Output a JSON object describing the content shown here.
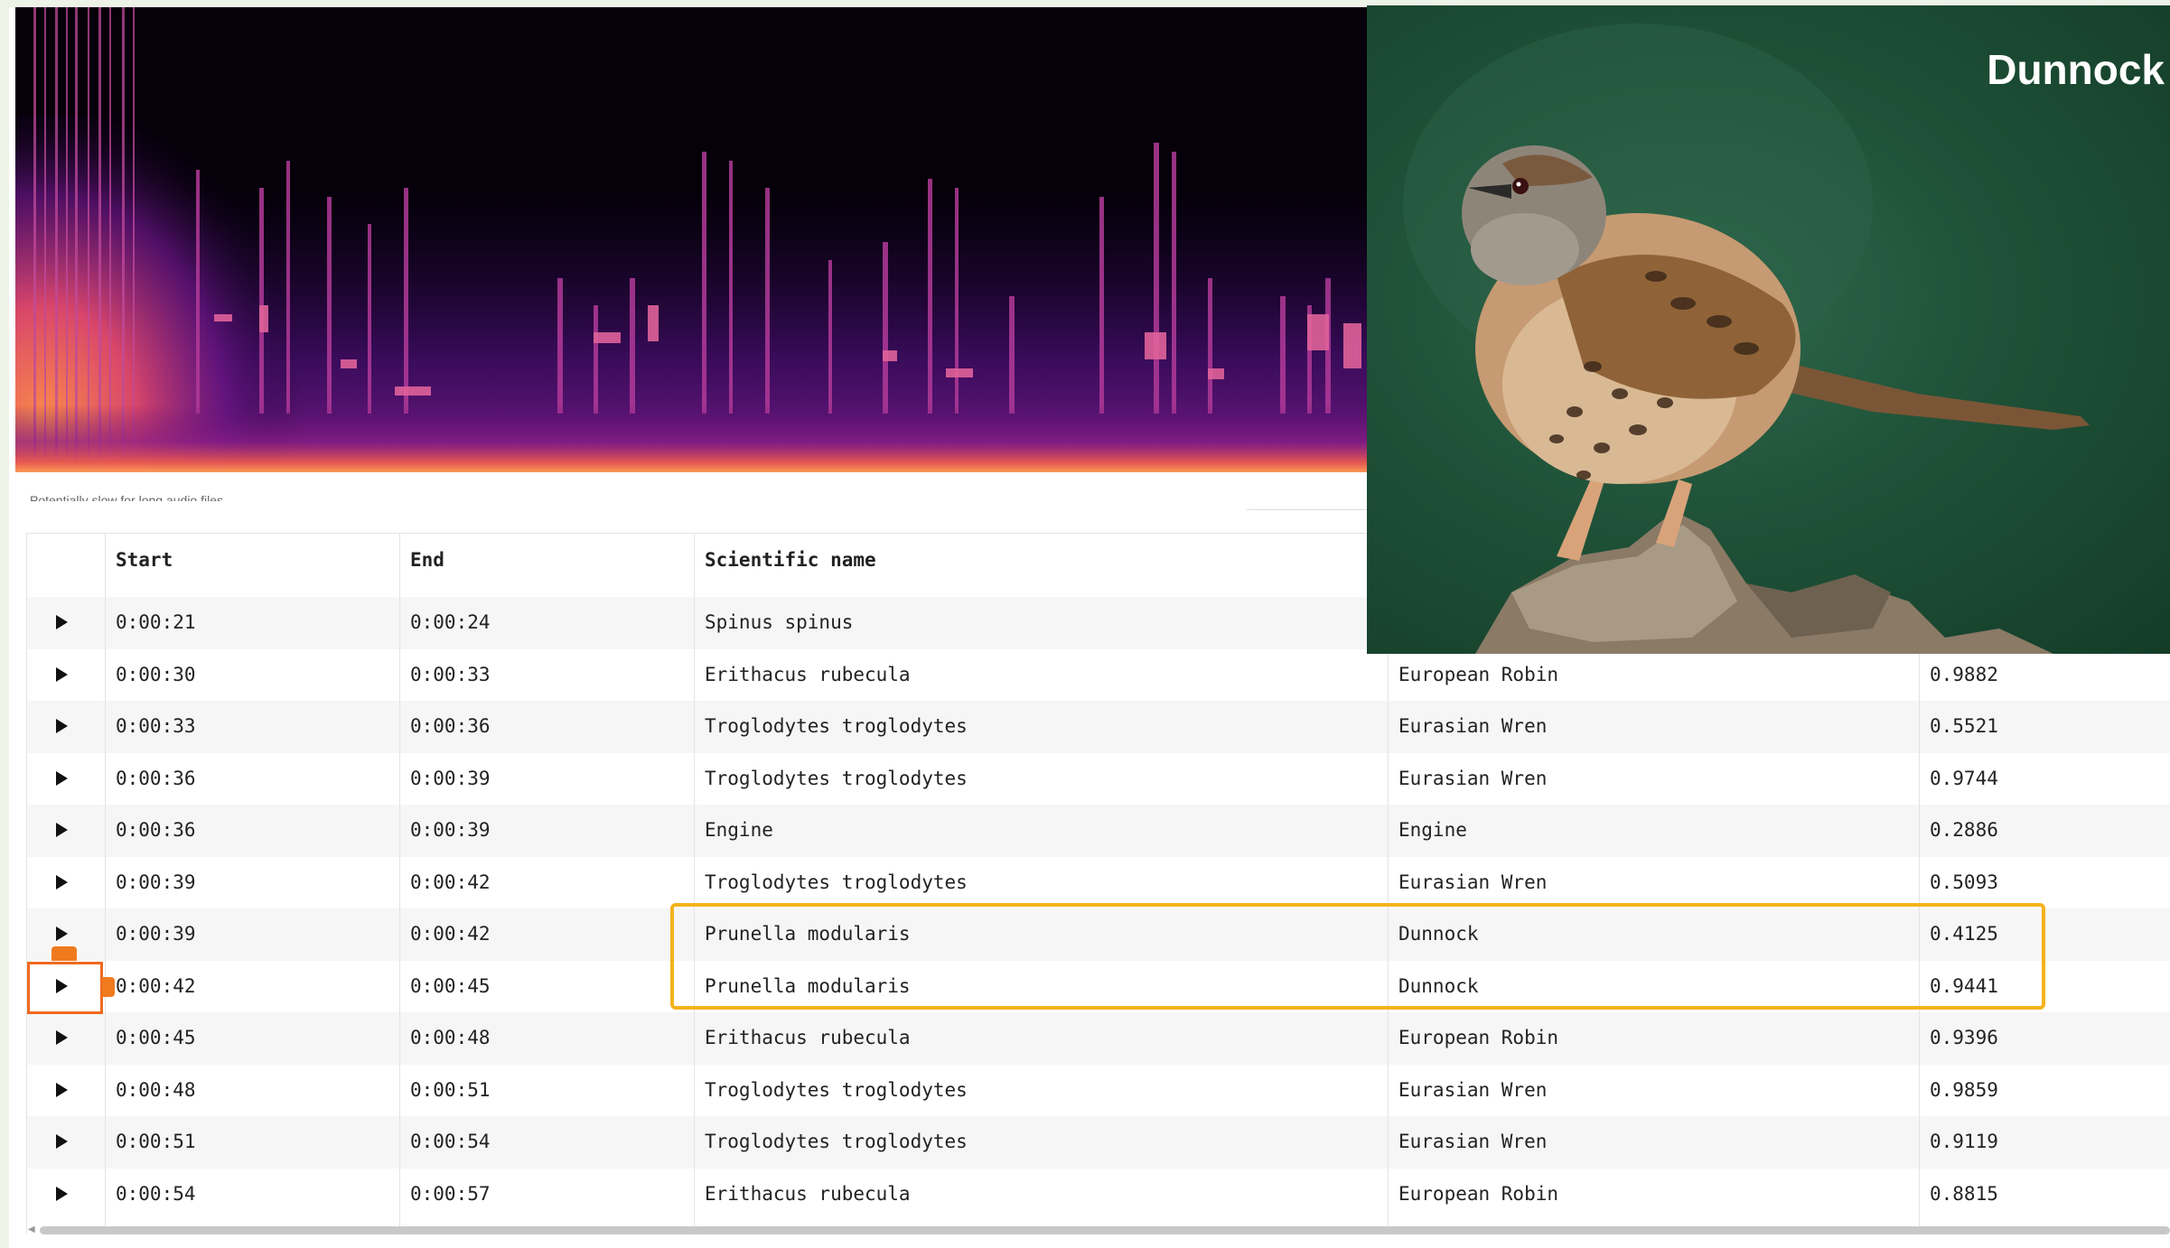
{
  "caption": "Potentially slow for long audio files",
  "bird_card": {
    "title": "Dunnock"
  },
  "table": {
    "headers": [
      "Start",
      "End",
      "Scientific name"
    ],
    "rows": [
      {
        "start": "0:00:21",
        "end": "0:00:24",
        "scientific": "Spinus spinus",
        "common": "",
        "confidence": ""
      },
      {
        "start": "0:00:30",
        "end": "0:00:33",
        "scientific": "Erithacus rubecula",
        "common": "European Robin",
        "confidence": "0.9882"
      },
      {
        "start": "0:00:33",
        "end": "0:00:36",
        "scientific": "Troglodytes troglodytes",
        "common": "Eurasian Wren",
        "confidence": "0.5521"
      },
      {
        "start": "0:00:36",
        "end": "0:00:39",
        "scientific": "Troglodytes troglodytes",
        "common": "Eurasian Wren",
        "confidence": "0.9744"
      },
      {
        "start": "0:00:36",
        "end": "0:00:39",
        "scientific": "Engine",
        "common": "Engine",
        "confidence": "0.2886"
      },
      {
        "start": "0:00:39",
        "end": "0:00:42",
        "scientific": "Troglodytes troglodytes",
        "common": "Eurasian Wren",
        "confidence": "0.5093"
      },
      {
        "start": "0:00:39",
        "end": "0:00:42",
        "scientific": "Prunella modularis",
        "common": "Dunnock",
        "confidence": "0.4125"
      },
      {
        "start": "0:00:42",
        "end": "0:00:45",
        "scientific": "Prunella modularis",
        "common": "Dunnock",
        "confidence": "0.9441"
      },
      {
        "start": "0:00:45",
        "end": "0:00:48",
        "scientific": "Erithacus rubecula",
        "common": "European Robin",
        "confidence": "0.9396"
      },
      {
        "start": "0:00:48",
        "end": "0:00:51",
        "scientific": "Troglodytes troglodytes",
        "common": "Eurasian Wren",
        "confidence": "0.9859"
      },
      {
        "start": "0:00:51",
        "end": "0:00:54",
        "scientific": "Troglodytes troglodytes",
        "common": "Eurasian Wren",
        "confidence": "0.9119"
      },
      {
        "start": "0:00:54",
        "end": "0:00:57",
        "scientific": "Erithacus rubecula",
        "common": "European Robin",
        "confidence": "0.8815"
      }
    ]
  },
  "colors": {
    "highlight": "#f5b21b",
    "selected": "#f06a1e",
    "spectrogram_base": "#050009"
  }
}
